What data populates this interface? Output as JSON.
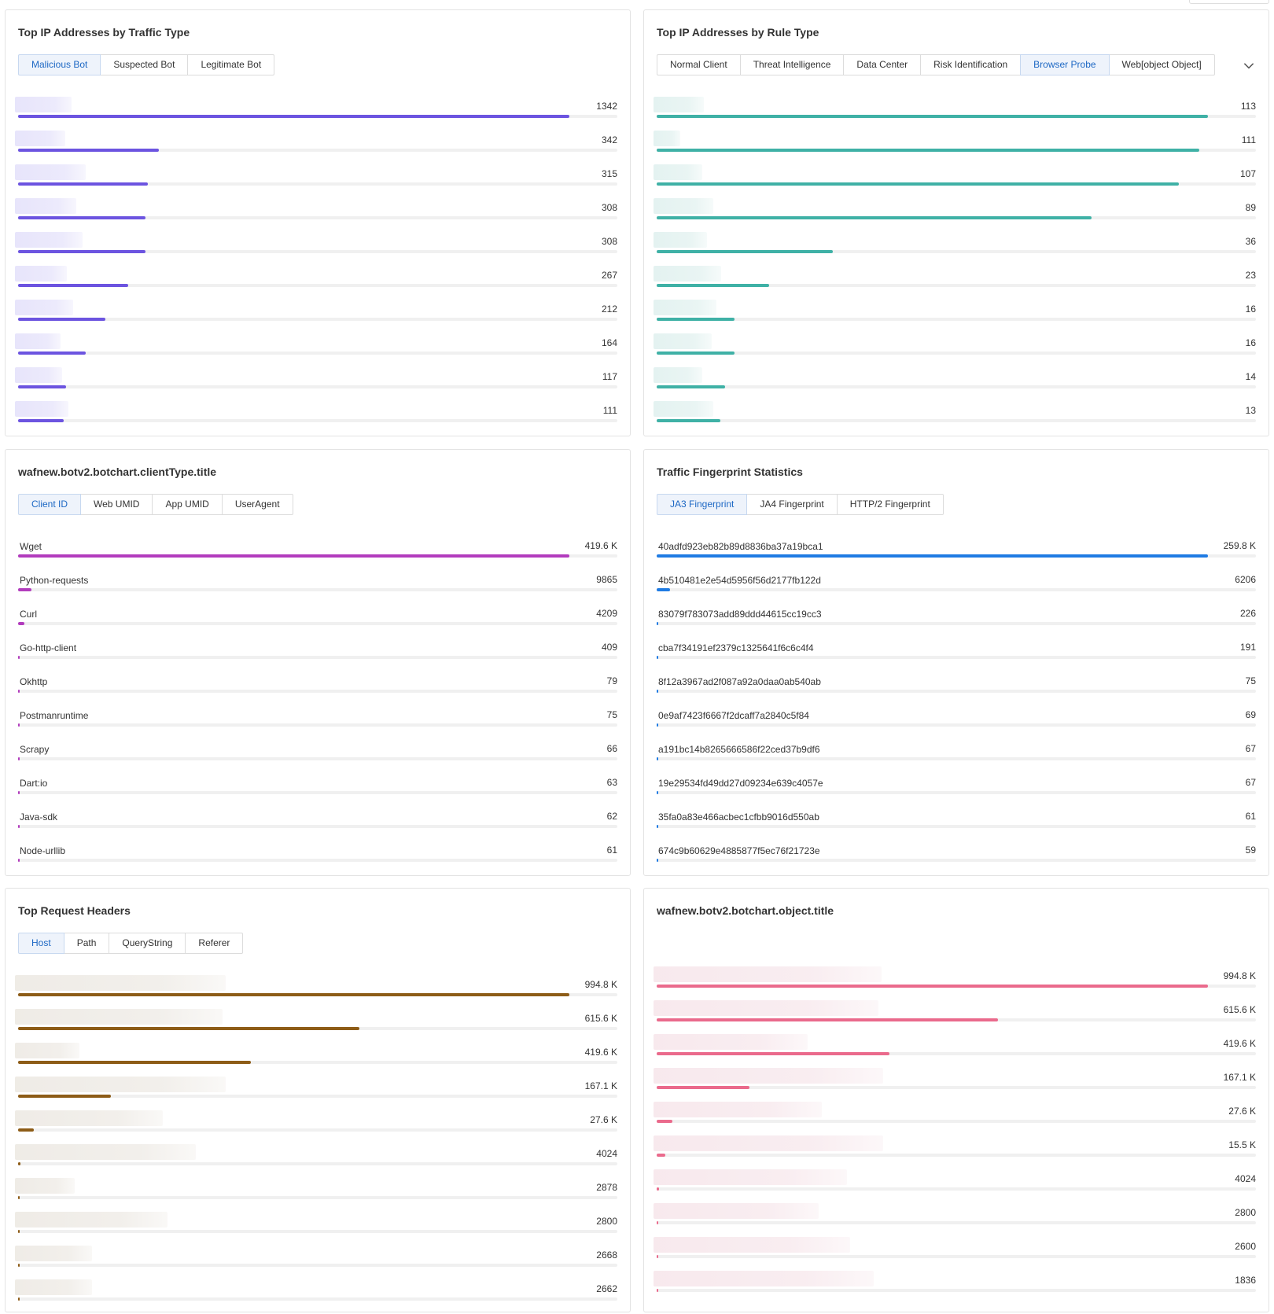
{
  "colors": {
    "ip_traffic": "#6c54e0",
    "ip_rule": "#3fb1a6",
    "client_type": "#b23cbd",
    "fingerprint": "#1f7be3",
    "headers": "#8d5c17",
    "object": "#ea6a8c"
  },
  "panels": {
    "ip_traffic": {
      "title": "Top IP Addresses by Traffic Type",
      "tabs": [
        "Malicious Bot",
        "Suspected Bot",
        "Legitimate Bot"
      ],
      "active_tab": 0,
      "rows": [
        {
          "value": "1342",
          "fraction": 0.92,
          "mask_color": "#e3e0fa"
        },
        {
          "value": "342",
          "fraction": 0.235,
          "mask_color": "#e3e0fa"
        },
        {
          "value": "315",
          "fraction": 0.217,
          "mask_color": "#e3e0fa"
        },
        {
          "value": "308",
          "fraction": 0.212,
          "mask_color": "#e3e0fa"
        },
        {
          "value": "308",
          "fraction": 0.212,
          "mask_color": "#e3e0fa"
        },
        {
          "value": "267",
          "fraction": 0.184,
          "mask_color": "#e3e0fa"
        },
        {
          "value": "212",
          "fraction": 0.146,
          "mask_color": "#e3e0fa"
        },
        {
          "value": "164",
          "fraction": 0.113,
          "mask_color": "#e3e0fa"
        },
        {
          "value": "117",
          "fraction": 0.08,
          "mask_color": "#e3e0fa"
        },
        {
          "value": "111",
          "fraction": 0.076,
          "mask_color": "#e3e0fa"
        }
      ]
    },
    "ip_rule": {
      "title": "Top IP Addresses by Rule Type",
      "tabs": [
        "Normal Client",
        "Threat Intelligence",
        "Data Center",
        "Risk Identification",
        "Browser Probe",
        "Web[object Object]"
      ],
      "active_tab": 4,
      "rows": [
        {
          "value": "113",
          "fraction": 0.92,
          "mask_color": "#dff0ee"
        },
        {
          "value": "111",
          "fraction": 0.905,
          "mask_color": "#dff0ee"
        },
        {
          "value": "107",
          "fraction": 0.872,
          "mask_color": "#dff0ee"
        },
        {
          "value": "89",
          "fraction": 0.726,
          "mask_color": "#dff0ee"
        },
        {
          "value": "36",
          "fraction": 0.294,
          "mask_color": "#dff0ee"
        },
        {
          "value": "23",
          "fraction": 0.188,
          "mask_color": "#dff0ee"
        },
        {
          "value": "16",
          "fraction": 0.13,
          "mask_color": "#dff0ee"
        },
        {
          "value": "16",
          "fraction": 0.13,
          "mask_color": "#dff0ee"
        },
        {
          "value": "14",
          "fraction": 0.114,
          "mask_color": "#dff0ee"
        },
        {
          "value": "13",
          "fraction": 0.106,
          "mask_color": "#dff0ee"
        }
      ]
    },
    "client_type": {
      "title": "wafnew.botv2.botchart.clientType.title",
      "tabs": [
        "Client ID",
        "Web UMID",
        "App UMID",
        "UserAgent"
      ],
      "active_tab": 0,
      "rows": [
        {
          "label": "Wget",
          "value": "419.6 K",
          "fraction": 0.92
        },
        {
          "label": "Python-requests",
          "value": "9865",
          "fraction": 0.022
        },
        {
          "label": "Curl",
          "value": "4209",
          "fraction": 0.01
        },
        {
          "label": "Go-http-client",
          "value": "409",
          "fraction": 0.003
        },
        {
          "label": "Okhttp",
          "value": "79",
          "fraction": 0.003
        },
        {
          "label": "Postmanruntime",
          "value": "75",
          "fraction": 0.003
        },
        {
          "label": "Scrapy",
          "value": "66",
          "fraction": 0.003
        },
        {
          "label": "Dart:io",
          "value": "63",
          "fraction": 0.003
        },
        {
          "label": "Java-sdk",
          "value": "62",
          "fraction": 0.003
        },
        {
          "label": "Node-urllib",
          "value": "61",
          "fraction": 0.003
        }
      ]
    },
    "fingerprint": {
      "title": "Traffic Fingerprint Statistics",
      "tabs": [
        "JA3 Fingerprint",
        "JA4 Fingerprint",
        "HTTP/2 Fingerprint"
      ],
      "active_tab": 0,
      "rows": [
        {
          "label": "40adfd923eb82b89d8836ba37a19bca1",
          "value": "259.8 K",
          "fraction": 0.92
        },
        {
          "label": "4b510481e2e54d5956f56d2177fb122d",
          "value": "6206",
          "fraction": 0.022
        },
        {
          "label": "83079f783073add89ddd44615cc19cc3",
          "value": "226",
          "fraction": 0.003
        },
        {
          "label": "cba7f34191ef2379c1325641f6c6c4f4",
          "value": "191",
          "fraction": 0.003
        },
        {
          "label": "8f12a3967ad2f087a92a0daa0ab540ab",
          "value": "75",
          "fraction": 0.003
        },
        {
          "label": "0e9af7423f6667f2dcaff7a2840c5f84",
          "value": "69",
          "fraction": 0.003
        },
        {
          "label": "a191bc14b8265666586f22ced37b9df6",
          "value": "67",
          "fraction": 0.003
        },
        {
          "label": "19e29534fd49dd27d09234e639c4057e",
          "value": "67",
          "fraction": 0.003
        },
        {
          "label": "35fa0a83e466acbec1cfbb9016d550ab",
          "value": "61",
          "fraction": 0.003
        },
        {
          "label": "674c9b60629e4885877f5ec76f21723e",
          "value": "59",
          "fraction": 0.003
        }
      ]
    },
    "headers": {
      "title": "Top Request Headers",
      "tabs": [
        "Host",
        "Path",
        "QueryString",
        "Referer"
      ],
      "active_tab": 0,
      "rows": [
        {
          "value": "994.8 K",
          "fraction": 0.92,
          "mask_color": "#ece8e2"
        },
        {
          "value": "615.6 K",
          "fraction": 0.57,
          "mask_color": "#ece8e2"
        },
        {
          "value": "419.6 K",
          "fraction": 0.388,
          "mask_color": "#ece8e2"
        },
        {
          "value": "167.1 K",
          "fraction": 0.155,
          "mask_color": "#ece8e2"
        },
        {
          "value": "27.6 K",
          "fraction": 0.026,
          "mask_color": "#ece8e2"
        },
        {
          "value": "4024",
          "fraction": 0.004,
          "mask_color": "#ece8e2"
        },
        {
          "value": "2878",
          "fraction": 0.003,
          "mask_color": "#ece8e2"
        },
        {
          "value": "2800",
          "fraction": 0.003,
          "mask_color": "#ece8e2"
        },
        {
          "value": "2668",
          "fraction": 0.003,
          "mask_color": "#ece8e2"
        },
        {
          "value": "2662",
          "fraction": 0.003,
          "mask_color": "#ece8e2"
        }
      ]
    },
    "object": {
      "title": "wafnew.botv2.botchart.object.title",
      "tabs": [],
      "rows": [
        {
          "value": "994.8 K",
          "fraction": 0.92,
          "mask_color": "#f6e5ea"
        },
        {
          "value": "615.6 K",
          "fraction": 0.57,
          "mask_color": "#f6e5ea"
        },
        {
          "value": "419.6 K",
          "fraction": 0.388,
          "mask_color": "#f6e5ea"
        },
        {
          "value": "167.1 K",
          "fraction": 0.155,
          "mask_color": "#f6e5ea"
        },
        {
          "value": "27.6 K",
          "fraction": 0.026,
          "mask_color": "#f6e5ea"
        },
        {
          "value": "15.5 K",
          "fraction": 0.015,
          "mask_color": "#f6e5ea"
        },
        {
          "value": "4024",
          "fraction": 0.004,
          "mask_color": "#f6e5ea"
        },
        {
          "value": "2800",
          "fraction": 0.003,
          "mask_color": "#f6e5ea"
        },
        {
          "value": "2600",
          "fraction": 0.003,
          "mask_color": "#f6e5ea"
        },
        {
          "value": "1836",
          "fraction": 0.003,
          "mask_color": "#f6e5ea"
        }
      ]
    }
  }
}
